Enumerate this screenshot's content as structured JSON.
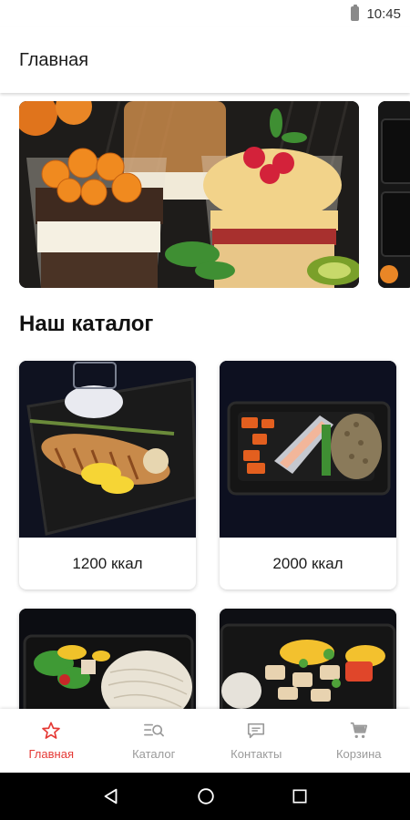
{
  "status_bar": {
    "time": "10:45"
  },
  "app_bar": {
    "title": "Главная"
  },
  "catalog": {
    "heading": "Наш каталог",
    "items": [
      {
        "label": "1200 ккал"
      },
      {
        "label": "2000 ккал"
      },
      {
        "label": ""
      },
      {
        "label": ""
      }
    ]
  },
  "bottom_nav": {
    "items": [
      {
        "label": "Главная",
        "icon": "star-icon",
        "active": true
      },
      {
        "label": "Каталог",
        "icon": "catalog-search-icon",
        "active": false
      },
      {
        "label": "Контакты",
        "icon": "chat-icon",
        "active": false
      },
      {
        "label": "Корзина",
        "icon": "cart-icon",
        "active": false
      }
    ]
  },
  "colors": {
    "accent": "#e53935",
    "inactive": "#9a9a9a"
  }
}
